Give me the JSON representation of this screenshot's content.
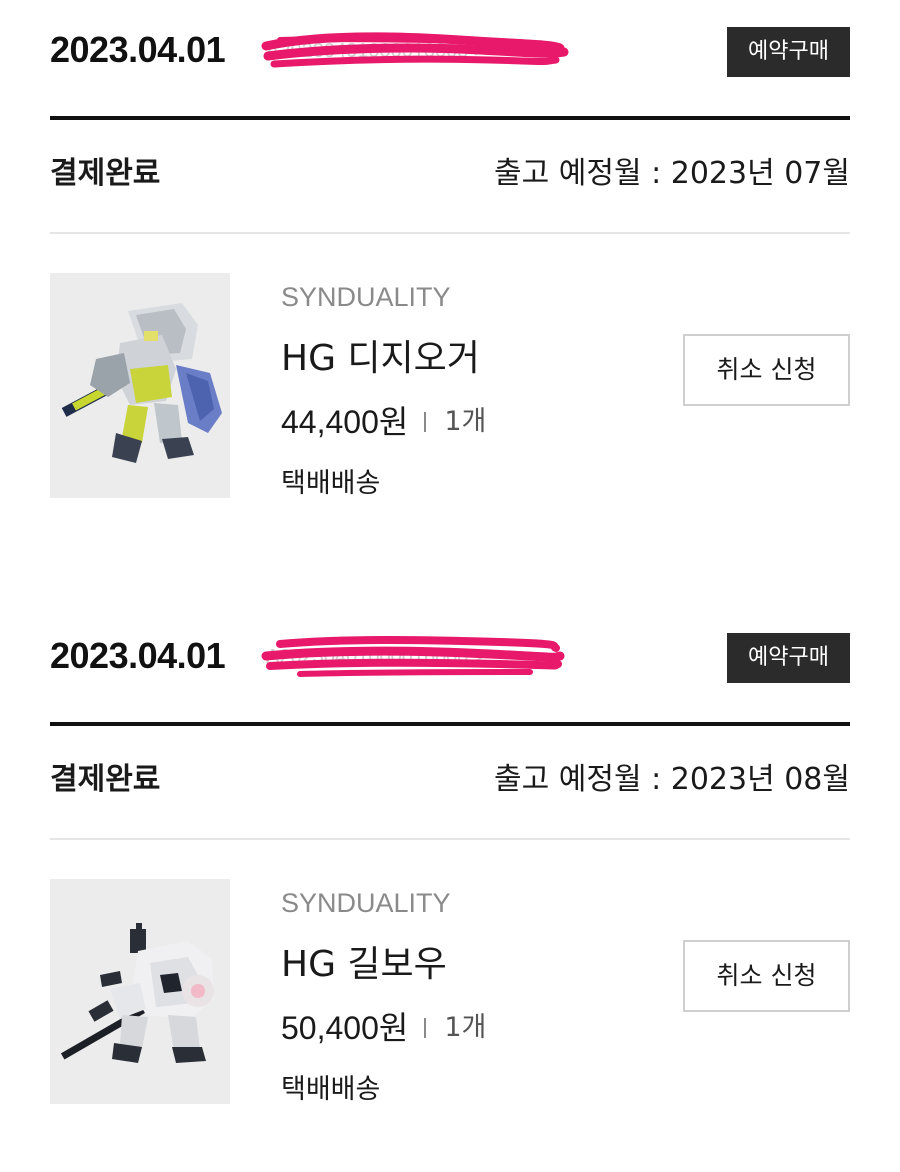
{
  "orders": [
    {
      "date": "2023.04.01",
      "order_number": "A20230401000010005 >",
      "badge": "예약구매",
      "status": "결제완료",
      "ship_month": "출고 예정월 : 2023년 07월",
      "product": {
        "brand": "SYNDUALITY",
        "name": "HG 디지오거",
        "price": "44,400원",
        "quantity": "1개",
        "delivery": "택배배송",
        "image_icon": "robot-model-yellow-icon"
      },
      "cancel_label": "취소 신청"
    },
    {
      "date": "2023.04.01",
      "order_number": "A20230401000016000 >",
      "badge": "예약구매",
      "status": "결제완료",
      "ship_month": "출고 예정월 : 2023년 08월",
      "product": {
        "brand": "SYNDUALITY",
        "name": "HG 길보우",
        "price": "50,400원",
        "quantity": "1개",
        "delivery": "택배배송",
        "image_icon": "robot-model-white-icon"
      },
      "cancel_label": "취소 신청"
    }
  ],
  "colors": {
    "badge_bg": "#2b2b2b",
    "redaction": "#e8196b",
    "brand_text": "#8a8a8a",
    "divider": "#e6e6e6"
  }
}
